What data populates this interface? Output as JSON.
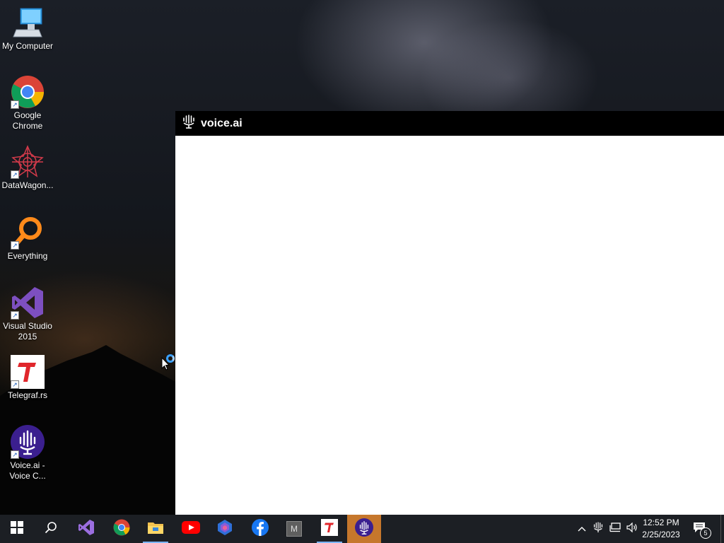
{
  "desktop": {
    "icons": [
      {
        "label": "My Computer",
        "icon": "computer-icon"
      },
      {
        "label": "Google Chrome",
        "icon": "chrome-icon"
      },
      {
        "label": "DataWagon...",
        "icon": "datawagon-icon"
      },
      {
        "label": "Everything",
        "icon": "everything-search-icon"
      },
      {
        "label": "Visual Studio 2015",
        "icon": "visual-studio-icon"
      },
      {
        "label": "Telegraf.rs",
        "icon": "telegraf-icon"
      },
      {
        "label": "Voice.ai - Voice C...",
        "icon": "voiceai-icon"
      }
    ]
  },
  "app_window": {
    "title": "voice.ai",
    "icon": "voiceai-logo-icon"
  },
  "taskbar": {
    "items": [
      {
        "name": "start",
        "icon": "windows-start-icon"
      },
      {
        "name": "search",
        "icon": "search-icon"
      },
      {
        "name": "visual-studio",
        "icon": "visual-studio-icon"
      },
      {
        "name": "chrome",
        "icon": "chrome-icon"
      },
      {
        "name": "file-explorer",
        "icon": "folder-icon"
      },
      {
        "name": "youtube",
        "icon": "youtube-icon"
      },
      {
        "name": "copilot",
        "icon": "copilot-icon"
      },
      {
        "name": "facebook",
        "icon": "facebook-icon"
      },
      {
        "name": "m-app",
        "icon": "m-app-icon",
        "letter": "M"
      },
      {
        "name": "telegraf",
        "icon": "telegraf-icon"
      },
      {
        "name": "voiceai",
        "icon": "voiceai-icon"
      }
    ],
    "clock": {
      "time": "12:52 PM",
      "date": "2/25/2023"
    },
    "notifications_count": "5"
  },
  "colors": {
    "taskbar_bg": "#1c1f24",
    "active_app_bg": "#c6772c",
    "voiceai_purple": "#3b1f8f",
    "telegraf_red": "#e0262b"
  }
}
